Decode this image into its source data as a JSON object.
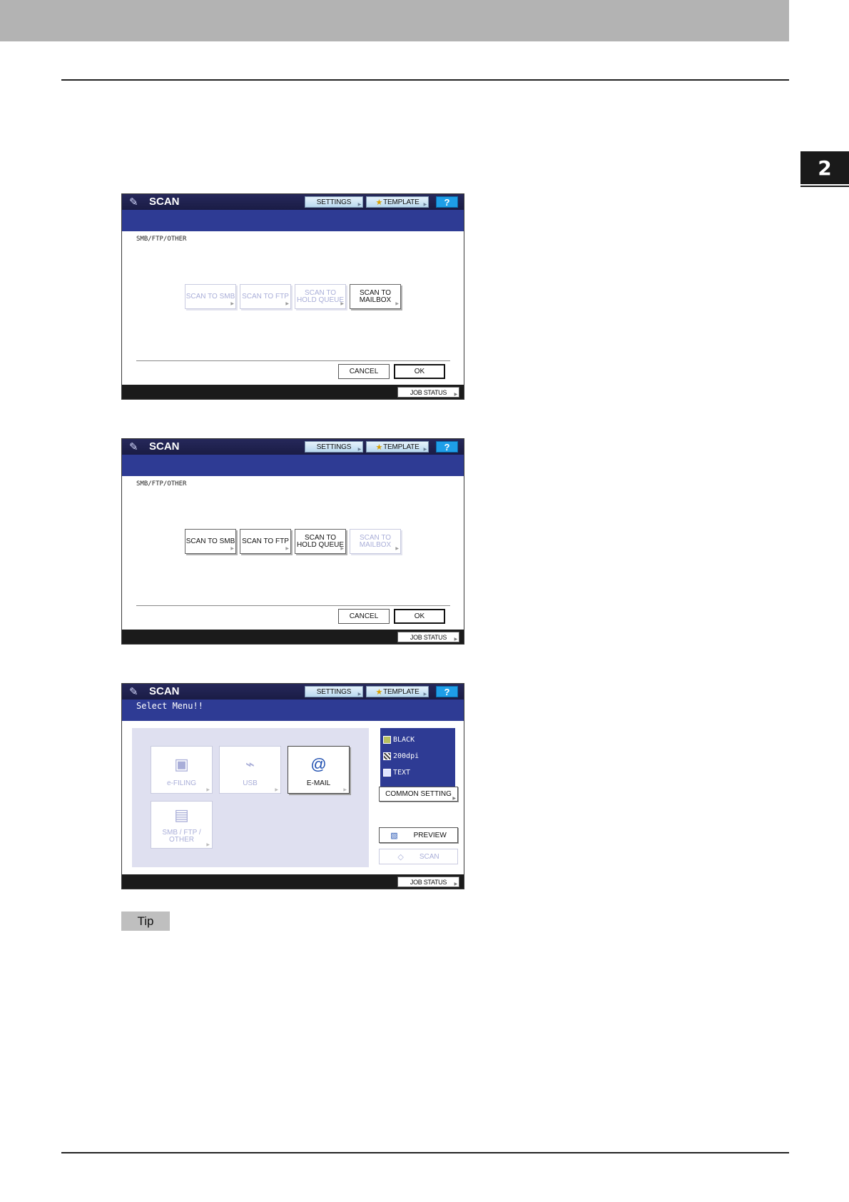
{
  "page": {
    "chapter_number": "2"
  },
  "screens": [
    {
      "title": "SCAN",
      "toolbar": {
        "settings": "SETTINGS",
        "template": "TEMPLATE",
        "help": "?"
      },
      "breadcrumb": "SMB/FTP/OTHER",
      "options": [
        {
          "label": "SCAN TO SMB",
          "enabled": false
        },
        {
          "label": "SCAN TO FTP",
          "enabled": false
        },
        {
          "label": "SCAN TO HOLD QUEUE",
          "enabled": false
        },
        {
          "label": "SCAN TO MAILBOX",
          "enabled": true
        }
      ],
      "cancel": "CANCEL",
      "ok": "OK",
      "job_status": "JOB STATUS"
    },
    {
      "title": "SCAN",
      "toolbar": {
        "settings": "SETTINGS",
        "template": "TEMPLATE",
        "help": "?"
      },
      "breadcrumb": "SMB/FTP/OTHER",
      "options": [
        {
          "label": "SCAN TO SMB",
          "enabled": true
        },
        {
          "label": "SCAN TO FTP",
          "enabled": true
        },
        {
          "label": "SCAN TO HOLD QUEUE",
          "enabled": true
        },
        {
          "label": "SCAN TO MAILBOX",
          "enabled": false
        }
      ],
      "cancel": "CANCEL",
      "ok": "OK",
      "job_status": "JOB STATUS"
    },
    {
      "title": "SCAN",
      "toolbar": {
        "settings": "SETTINGS",
        "template": "TEMPLATE",
        "help": "?"
      },
      "message": "Select Menu!!",
      "functions": [
        {
          "label": "e-FILING",
          "enabled": false
        },
        {
          "label": "USB",
          "enabled": false
        },
        {
          "label": "E-MAIL",
          "enabled": true
        },
        {
          "label": "SMB / FTP / OTHER",
          "enabled": false
        }
      ],
      "settings_summary": [
        {
          "label": "BLACK"
        },
        {
          "label": "200dpi"
        },
        {
          "label": "TEXT"
        }
      ],
      "common_setting": "COMMON SETTING",
      "preview": "PREVIEW",
      "scan": "SCAN",
      "job_status": "JOB STATUS"
    }
  ],
  "tip_label": "Tip"
}
